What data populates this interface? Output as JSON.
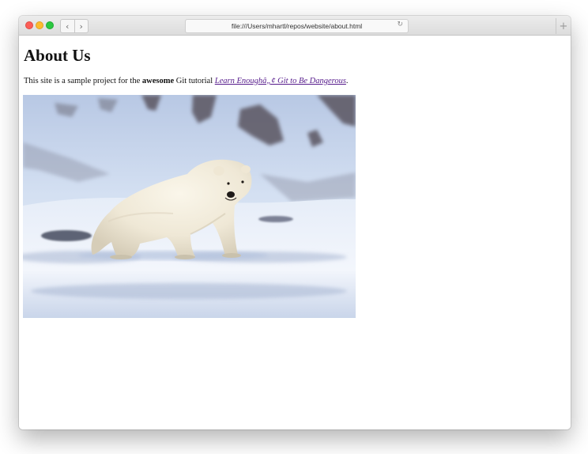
{
  "browser": {
    "url": "file:///Users/mhartl/repos/website/about.html",
    "back_glyph": "‹",
    "forward_glyph": "›",
    "reload_glyph": "↻",
    "new_tab_glyph": "+"
  },
  "page": {
    "heading": "About Us",
    "intro_before": "This site is a sample project for the ",
    "intro_bold": "awesome",
    "intro_middle": " Git tutorial ",
    "intro_link": "Learn Enoughâ„¢ Git to Be Dangerous",
    "intro_after": "."
  },
  "image": {
    "subject": "polar-bear-on-snow"
  },
  "colors": {
    "link": "#551a8b",
    "close": "#fc5e57",
    "minimize": "#fdbb2e",
    "zoom": "#2ac840"
  }
}
